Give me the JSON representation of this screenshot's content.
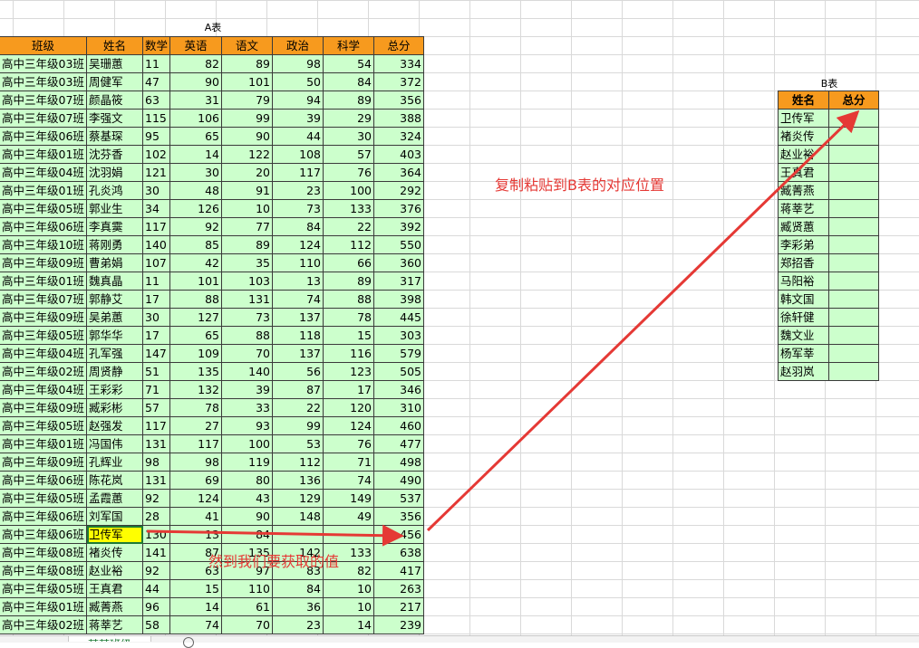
{
  "tableA": {
    "title": "A表",
    "headers": [
      "班级",
      "姓名",
      "数学",
      "英语",
      "语文",
      "政治",
      "科学",
      "总分"
    ],
    "rows": [
      [
        "高中三年级03班",
        "吴珊蕙",
        "11",
        "82",
        "89",
        "98",
        "54",
        "334"
      ],
      [
        "高中三年级03班",
        "周健军",
        "47",
        "90",
        "101",
        "50",
        "84",
        "372"
      ],
      [
        "高中三年级07班",
        "颜晶筱",
        "63",
        "31",
        "79",
        "94",
        "89",
        "356"
      ],
      [
        "高中三年级07班",
        "李强文",
        "115",
        "106",
        "99",
        "39",
        "29",
        "388"
      ],
      [
        "高中三年级06班",
        "蔡基琛",
        "95",
        "65",
        "90",
        "44",
        "30",
        "324"
      ],
      [
        "高中三年级01班",
        "沈芬香",
        "102",
        "14",
        "122",
        "108",
        "57",
        "403"
      ],
      [
        "高中三年级04班",
        "沈羽娟",
        "121",
        "30",
        "20",
        "117",
        "76",
        "364"
      ],
      [
        "高中三年级01班",
        "孔炎鸿",
        "30",
        "48",
        "91",
        "23",
        "100",
        "292"
      ],
      [
        "高中三年级05班",
        "郭业生",
        "34",
        "126",
        "10",
        "73",
        "133",
        "376"
      ],
      [
        "高中三年级06班",
        "李真霙",
        "117",
        "92",
        "77",
        "84",
        "22",
        "392"
      ],
      [
        "高中三年级10班",
        "蒋刚勇",
        "140",
        "85",
        "89",
        "124",
        "112",
        "550"
      ],
      [
        "高中三年级09班",
        "曹弟娟",
        "107",
        "42",
        "35",
        "110",
        "66",
        "360"
      ],
      [
        "高中三年级01班",
        "魏真晶",
        "11",
        "101",
        "103",
        "13",
        "89",
        "317"
      ],
      [
        "高中三年级07班",
        "郭静艾",
        "17",
        "88",
        "131",
        "74",
        "88",
        "398"
      ],
      [
        "高中三年级09班",
        "吴弟蕙",
        "30",
        "127",
        "73",
        "137",
        "78",
        "445"
      ],
      [
        "高中三年级05班",
        "郭华华",
        "17",
        "65",
        "88",
        "118",
        "15",
        "303"
      ],
      [
        "高中三年级04班",
        "孔军强",
        "147",
        "109",
        "70",
        "137",
        "116",
        "579"
      ],
      [
        "高中三年级02班",
        "周贤静",
        "51",
        "135",
        "140",
        "56",
        "123",
        "505"
      ],
      [
        "高中三年级04班",
        "王彩彩",
        "71",
        "132",
        "39",
        "87",
        "17",
        "346"
      ],
      [
        "高中三年级09班",
        "臧彩彬",
        "57",
        "78",
        "33",
        "22",
        "120",
        "310"
      ],
      [
        "高中三年级05班",
        "赵强发",
        "117",
        "27",
        "93",
        "99",
        "124",
        "460"
      ],
      [
        "高中三年级01班",
        "冯国伟",
        "131",
        "117",
        "100",
        "53",
        "76",
        "477"
      ],
      [
        "高中三年级09班",
        "孔辉业",
        "98",
        "98",
        "119",
        "112",
        "71",
        "498"
      ],
      [
        "高中三年级06班",
        "陈花岚",
        "131",
        "69",
        "80",
        "136",
        "74",
        "490"
      ],
      [
        "高中三年级05班",
        "孟霞蕙",
        "92",
        "124",
        "43",
        "129",
        "149",
        "537"
      ],
      [
        "高中三年级06班",
        "刘军国",
        "28",
        "41",
        "90",
        "148",
        "49",
        "356"
      ],
      [
        "高中三年级06班",
        "卫传军",
        "130",
        "13",
        "84",
        "",
        "",
        "456"
      ],
      [
        "高中三年级08班",
        "褚炎传",
        "141",
        "87",
        "135",
        "142",
        "133",
        "638"
      ],
      [
        "高中三年级08班",
        "赵业裕",
        "92",
        "63",
        "97",
        "83",
        "82",
        "417"
      ],
      [
        "高中三年级05班",
        "王真君",
        "44",
        "15",
        "110",
        "84",
        "10",
        "263"
      ],
      [
        "高中三年级01班",
        "臧菁燕",
        "96",
        "14",
        "61",
        "36",
        "10",
        "217"
      ],
      [
        "高中三年级02班",
        "蒋莘艺",
        "58",
        "74",
        "70",
        "23",
        "14",
        "239"
      ]
    ]
  },
  "tableB": {
    "title": "B表",
    "headers": [
      "姓名",
      "总分"
    ],
    "names": [
      "卫传军",
      "褚炎传",
      "赵业裕",
      "王真君",
      "臧菁燕",
      "蒋莘艺",
      "臧贤蕙",
      "李彩弟",
      "郑招香",
      "马阳裕",
      "韩文国",
      "徐轩健",
      "魏文业",
      "杨军莘",
      "赵羽岚"
    ]
  },
  "annotations": {
    "copy_note": "复制粘贴到B表的对应位置",
    "find_note": "然到我们要获取的值",
    "color": "#e53935"
  },
  "sheet_tab": "某某班级"
}
